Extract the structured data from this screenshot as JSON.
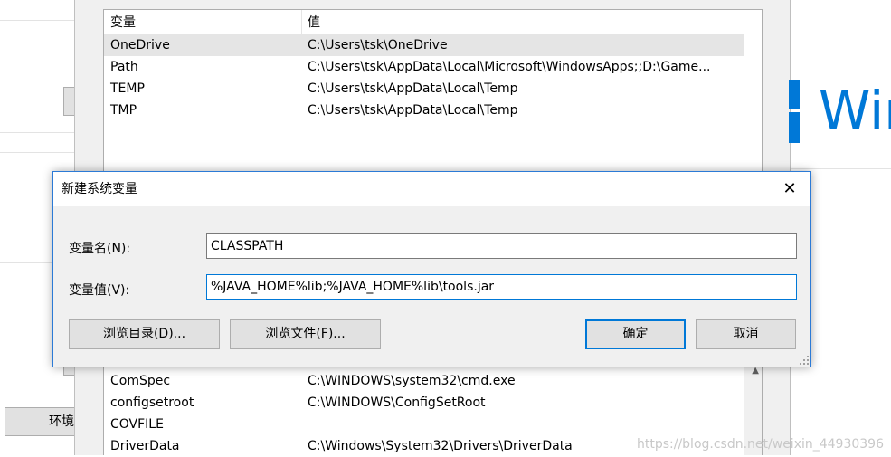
{
  "env_window": {
    "columns": [
      "变量",
      "值"
    ],
    "user_vars": [
      {
        "name": "OneDrive",
        "value": "C:\\Users\\tsk\\OneDrive"
      },
      {
        "name": "Path",
        "value": "C:\\Users\\tsk\\AppData\\Local\\Microsoft\\WindowsApps;;D:\\Game..."
      },
      {
        "name": "TEMP",
        "value": "C:\\Users\\tsk\\AppData\\Local\\Temp"
      },
      {
        "name": "TMP",
        "value": "C:\\Users\\tsk\\AppData\\Local\\Temp"
      }
    ],
    "system_vars": [
      {
        "name": "ComSpec",
        "value": "C:\\WINDOWS\\system32\\cmd.exe"
      },
      {
        "name": "configsetroot",
        "value": "C:\\WINDOWS\\ConfigSetRoot"
      },
      {
        "name": "COVFILE",
        "value": ""
      },
      {
        "name": "DriverData",
        "value": "C:\\Windows\\System32\\Drivers\\DriverData"
      }
    ]
  },
  "left_panel": {
    "env_button_label": "环境"
  },
  "brand": {
    "logo_text": "Win",
    "accent": "#0078d7"
  },
  "dialog": {
    "title": "新建系统变量",
    "close_glyph": "✕",
    "name_label": "变量名(N):",
    "name_value": "CLASSPATH",
    "value_label": "变量值(V):",
    "value_value": "%JAVA_HOME%lib;%JAVA_HOME%lib\\tools.jar",
    "browse_dir_label": "浏览目录(D)...",
    "browse_file_label": "浏览文件(F)...",
    "ok_label": "确定",
    "cancel_label": "取消"
  },
  "watermark": "https://blog.csdn.net/weixin_44930396"
}
